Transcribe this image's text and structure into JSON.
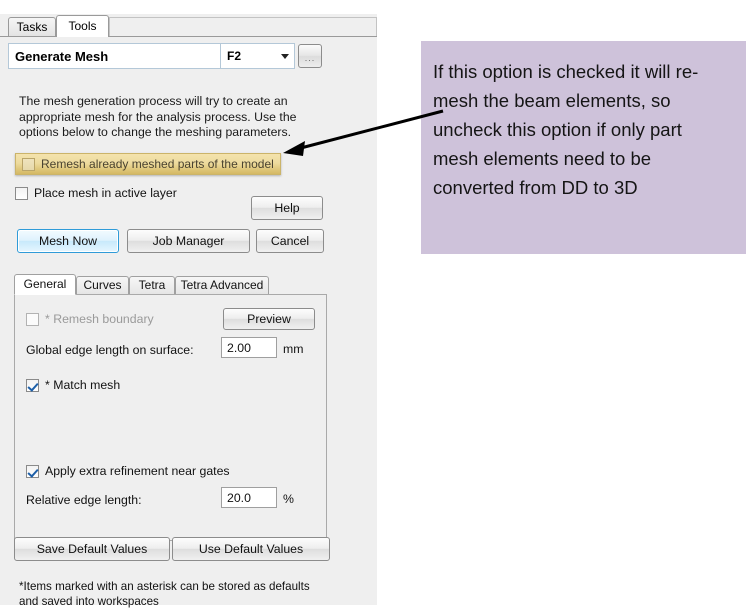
{
  "panel": {
    "top_tabs": [
      {
        "label": "Tasks",
        "active": false
      },
      {
        "label": "Tools",
        "active": true
      }
    ],
    "title_field": {
      "value": "Generate Mesh"
    },
    "shortcut_combo": {
      "value": "F2",
      "caret_icon": "chevron-down-icon"
    },
    "ellipsis_button": {
      "label": "..."
    },
    "description": "The mesh generation process will try to create an appropriate mesh for the analysis process. Use the options below to change the meshing parameters.",
    "options": [
      {
        "label": "Remesh already meshed parts of the model",
        "checked": false,
        "highlighted": true
      },
      {
        "label": "Place mesh in active layer",
        "checked": false,
        "highlighted": false
      }
    ],
    "help_button": "Help",
    "action_buttons": [
      {
        "label": "Mesh Now",
        "primary": true
      },
      {
        "label": "Job Manager",
        "primary": false
      },
      {
        "label": "Cancel",
        "primary": false
      }
    ],
    "inner_tabs": [
      {
        "label": "General",
        "active": true
      },
      {
        "label": "Curves",
        "active": false
      },
      {
        "label": "Tetra",
        "active": false
      },
      {
        "label": "Tetra Advanced",
        "active": false
      }
    ],
    "general_tab": {
      "remesh_boundary": {
        "label": "* Remesh boundary",
        "checked": false,
        "disabled": true
      },
      "preview_button": "Preview",
      "global_edge_length": {
        "label": "Global edge length on surface:",
        "value": "2.00",
        "unit": "mm"
      },
      "match_mesh": {
        "label": "* Match mesh",
        "checked": true
      },
      "apply_extra_refinement": {
        "label": "Apply extra refinement near gates",
        "checked": true
      },
      "relative_edge_length": {
        "label": "Relative edge length:",
        "value": "20.0",
        "unit": "%"
      }
    },
    "default_buttons": [
      {
        "label": "Save Default Values"
      },
      {
        "label": "Use Default Values"
      }
    ],
    "footnote": "*Items marked with an asterisk can be stored as defaults and saved into workspaces"
  },
  "annotation": {
    "text": "If this option is checked it will re-mesh the beam elements, so uncheck this option if only part mesh elements need to be converted from DD to 3D",
    "background_color": "#cec2da",
    "arrow_color": "#000000"
  },
  "colors": {
    "panel_background": "#efefef",
    "highlight_row": "#e6d9ab",
    "primary_button_border": "#2f9bd8",
    "callout_background": "#cec2da"
  }
}
